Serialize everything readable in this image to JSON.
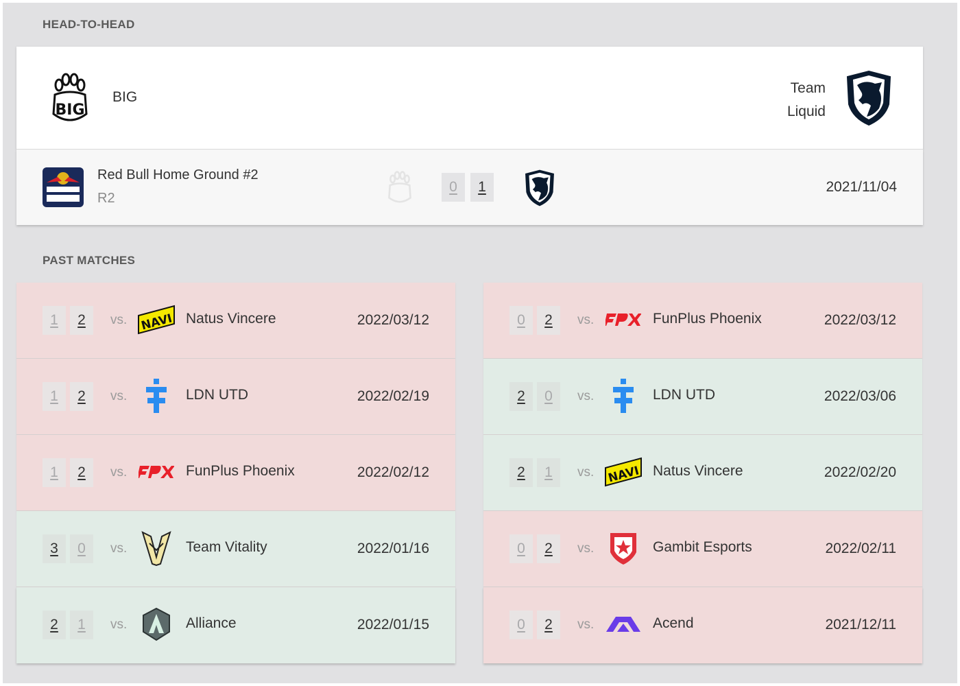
{
  "sections": {
    "h2h_title": "HEAD-TO-HEAD",
    "past_title": "PAST MATCHES"
  },
  "head_to_head": {
    "team_left": "BIG",
    "team_right_line1": "Team",
    "team_right_line2": "Liquid",
    "match": {
      "event": "Red Bull Home Ground #2",
      "round": "R2",
      "score_left": "0",
      "score_right": "1",
      "date": "2021/11/04"
    }
  },
  "vs_label": "vs.",
  "left_matches": [
    {
      "result": "loss",
      "score1": "1",
      "score2": "2",
      "opponent": "Natus Vincere",
      "logo": "navi",
      "date": "2022/03/12"
    },
    {
      "result": "loss",
      "score1": "1",
      "score2": "2",
      "opponent": "LDN UTD",
      "logo": "ldn",
      "date": "2022/02/19"
    },
    {
      "result": "loss",
      "score1": "1",
      "score2": "2",
      "opponent": "FunPlus Phoenix",
      "logo": "fpx",
      "date": "2022/02/12"
    },
    {
      "result": "win",
      "score1": "3",
      "score2": "0",
      "opponent": "Team Vitality",
      "logo": "vitality",
      "date": "2022/01/16"
    },
    {
      "result": "win",
      "score1": "2",
      "score2": "1",
      "opponent": "Alliance",
      "logo": "alliance",
      "date": "2022/01/15"
    }
  ],
  "right_matches": [
    {
      "result": "loss",
      "score1": "0",
      "score2": "2",
      "opponent": "FunPlus Phoenix",
      "logo": "fpx",
      "date": "2022/03/12"
    },
    {
      "result": "win",
      "score1": "2",
      "score2": "0",
      "opponent": "LDN UTD",
      "logo": "ldn",
      "date": "2022/03/06"
    },
    {
      "result": "win",
      "score1": "2",
      "score2": "1",
      "opponent": "Natus Vincere",
      "logo": "navi",
      "date": "2022/02/20"
    },
    {
      "result": "loss",
      "score1": "0",
      "score2": "2",
      "opponent": "Gambit Esports",
      "logo": "gambit",
      "date": "2022/02/11"
    },
    {
      "result": "loss",
      "score1": "0",
      "score2": "2",
      "opponent": "Acend",
      "logo": "acend",
      "date": "2021/12/11"
    }
  ],
  "colors": {
    "loss_row": "#f1dada",
    "win_row": "#e1ece6",
    "navi_yellow": "#f4e800",
    "fpx_red": "#e8202a",
    "ldn_blue": "#2a8cf0",
    "gambit_red": "#e0303a",
    "acend_purple": "#6a3ce8"
  }
}
